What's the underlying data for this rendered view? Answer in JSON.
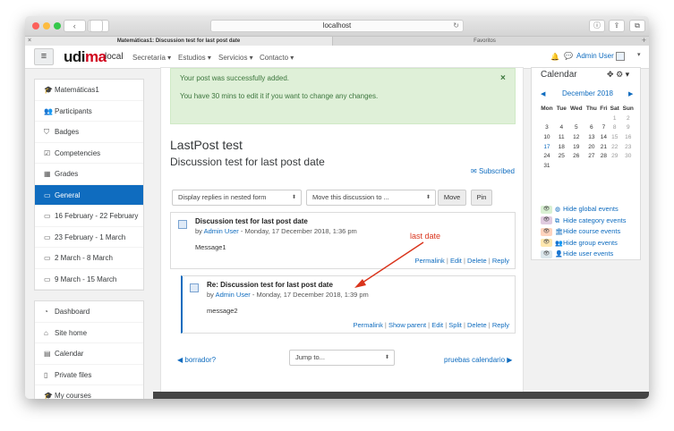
{
  "browser": {
    "url": "localhost",
    "tabs": [
      "Matemáticas1: Discussion test for last post date",
      "Favoritos"
    ],
    "nav_back": "‹",
    "nav_forward": "›"
  },
  "navbar": {
    "brand_main": "udima",
    "brand_sub": "local",
    "menus": [
      "Secretaría",
      "Estudios",
      "Servicios",
      "Contacto"
    ],
    "user": "Admin User"
  },
  "drawer": {
    "course_items": [
      {
        "label": "Matemáticas1",
        "icon": "graduation-cap-icon",
        "glyph": "🎓"
      },
      {
        "label": "Participants",
        "icon": "users-icon",
        "glyph": "👥"
      },
      {
        "label": "Badges",
        "icon": "shield-icon",
        "glyph": "⛉"
      },
      {
        "label": "Competencies",
        "icon": "checkbox-icon",
        "glyph": "☑"
      },
      {
        "label": "Grades",
        "icon": "table-icon",
        "glyph": "▦"
      },
      {
        "label": "General",
        "icon": "folder-icon",
        "glyph": "▭",
        "active": true
      },
      {
        "label": "16 February - 22 February",
        "icon": "folder-icon",
        "glyph": "▭"
      },
      {
        "label": "23 February - 1 March",
        "icon": "folder-icon",
        "glyph": "▭"
      },
      {
        "label": "2 March - 8 March",
        "icon": "folder-icon",
        "glyph": "▭"
      },
      {
        "label": "9 March - 15 March",
        "icon": "folder-icon",
        "glyph": "▭"
      }
    ],
    "site_items": [
      {
        "label": "Dashboard",
        "icon": "dashboard-icon",
        "glyph": "◔"
      },
      {
        "label": "Site home",
        "icon": "home-icon",
        "glyph": "⌂"
      },
      {
        "label": "Calendar",
        "icon": "calendar-icon",
        "glyph": "▤"
      },
      {
        "label": "Private files",
        "icon": "file-icon",
        "glyph": "▯"
      },
      {
        "label": "My courses",
        "icon": "graduation-cap-icon",
        "glyph": "🎓"
      }
    ]
  },
  "main": {
    "alert_line1": "Your post was successfully added.",
    "alert_line2": "You have 30 mins to edit it if you want to change any changes.",
    "page_title": "LastPost test",
    "discussion_title": "Discussion test for last post date",
    "subscribe": "Subscribed",
    "display_mode": "Display replies in nested form",
    "move_to": "Move this discussion to ...",
    "move_btn": "Move",
    "pin_btn": "Pin",
    "posts": [
      {
        "subject": "Discussion test for last post date",
        "by_prefix": "by",
        "author": "Admin User",
        "date": "- Monday, 17 December 2018, 1:36 pm",
        "message": "Message1",
        "commands": [
          "Permalink",
          "Edit",
          "Delete",
          "Reply"
        ]
      },
      {
        "subject": "Re: Discussion test for last post date",
        "by_prefix": "by",
        "author": "Admin User",
        "date": "- Monday, 17 December 2018, 1:39 pm",
        "message": "message2",
        "commands": [
          "Permalink",
          "Show parent",
          "Edit",
          "Split",
          "Delete",
          "Reply"
        ]
      }
    ],
    "annotation": "last date",
    "prev_link": "◀ borrador?",
    "jump_to": "Jump to...",
    "next_link": "pruebas calendario ▶"
  },
  "calendar": {
    "title": "Calendar",
    "month": "December 2018",
    "weekdays": [
      "Mon",
      "Tue",
      "Wed",
      "Thu",
      "Fri",
      "Sat",
      "Sun"
    ],
    "weeks": [
      [
        "",
        "",
        "",
        "",
        "",
        "1",
        "2"
      ],
      [
        "3",
        "4",
        "5",
        "6",
        "7",
        "8",
        "9"
      ],
      [
        "10",
        "11",
        "12",
        "13",
        "14",
        "15",
        "16"
      ],
      [
        "17",
        "18",
        "19",
        "20",
        "21",
        "22",
        "23"
      ],
      [
        "24",
        "25",
        "26",
        "27",
        "28",
        "29",
        "30"
      ],
      [
        "31",
        "",
        "",
        "",
        "",
        "",
        ""
      ]
    ],
    "today": "17",
    "events": [
      {
        "label": "Hide global events",
        "color": "#d9f0d3",
        "icon": "globe-icon",
        "glyph": "◍"
      },
      {
        "label": "Hide category events",
        "color": "#e0cbe0",
        "icon": "cubes-icon",
        "glyph": "⧉"
      },
      {
        "label": "Hide course events",
        "color": "#ffd3bd",
        "icon": "university-icon",
        "glyph": "🏛"
      },
      {
        "label": "Hide group events",
        "color": "#fee7ae",
        "icon": "group-icon",
        "glyph": "👥"
      },
      {
        "label": "Hide user events",
        "color": "#dce7ec",
        "icon": "user-icon",
        "glyph": "👤"
      }
    ]
  },
  "colors": {
    "accent": "#0f6cbf",
    "alert_bg": "#dff0d8",
    "annotation": "#d9341c",
    "brand_red": "#d0021b"
  }
}
